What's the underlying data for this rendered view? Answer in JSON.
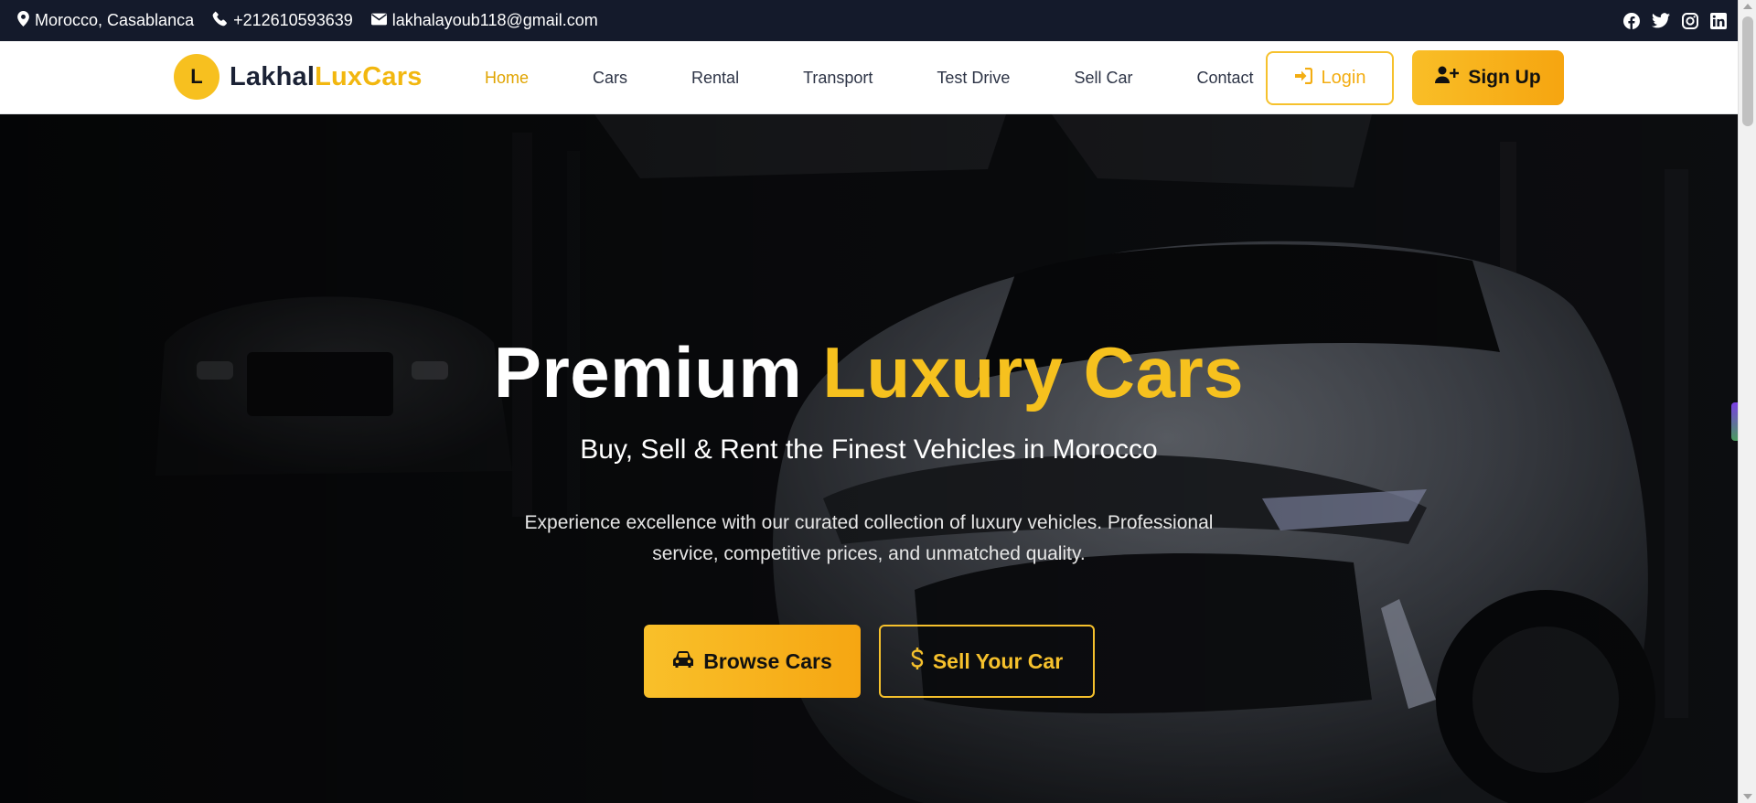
{
  "topbar": {
    "location": "Morocco, Casablanca",
    "phone": "+212610593639",
    "email": "lakhalayoub118@gmail.com",
    "social": [
      "facebook-icon",
      "twitter-icon",
      "instagram-icon",
      "linkedin-icon"
    ]
  },
  "logo": {
    "badge": "L",
    "part1": "Lakhal",
    "part2": "LuxCars"
  },
  "nav": {
    "items": [
      {
        "label": "Home",
        "active": true
      },
      {
        "label": "Cars"
      },
      {
        "label": "Rental"
      },
      {
        "label": "Transport"
      },
      {
        "label": "Test Drive"
      },
      {
        "label": "Sell Car"
      },
      {
        "label": "Contact"
      }
    ],
    "login": "Login",
    "signup": "Sign Up"
  },
  "hero": {
    "title_part1": "Premium",
    "title_part2": "Luxury Cars",
    "subtitle": "Buy, Sell & Rent the Finest Vehicles in Morocco",
    "description": "Experience excellence with our curated collection of luxury vehicles. Professional service, competitive prices, and unmatched quality.",
    "browse_button": "Browse Cars",
    "sell_button": "Sell Your Car"
  },
  "colors": {
    "accent": "#f6c11e",
    "topbar_bg": "#141a2b",
    "nav_text": "#2d3446"
  }
}
